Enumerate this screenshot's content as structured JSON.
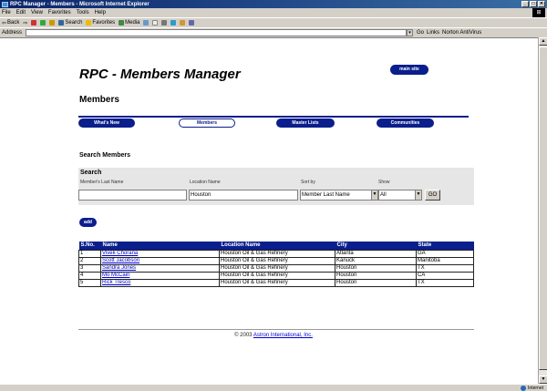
{
  "window": {
    "title": "RPC Manager - Members - Microsoft Internet Explorer",
    "buttons": [
      "_",
      "□",
      "✕"
    ]
  },
  "menu": [
    "File",
    "Edit",
    "View",
    "Favorites",
    "Tools",
    "Help"
  ],
  "toolbar": {
    "back": "Back",
    "search": "Search",
    "favorites": "Favorites",
    "media": "Media"
  },
  "address": {
    "label": "Address",
    "value": "",
    "go": "Go",
    "links": "Links",
    "norton": "Norton AntiVirus"
  },
  "page": {
    "title": "RPC - Members Manager",
    "main_site": "main site",
    "section": "Members",
    "nav": [
      {
        "label": "What's New",
        "active": false
      },
      {
        "label": "Members",
        "active": true
      },
      {
        "label": "Master Lists",
        "active": false
      },
      {
        "label": "Communities",
        "active": false
      }
    ]
  },
  "search": {
    "heading": "Search Members",
    "box_title": "Search",
    "last_name_label": "Member's Last Name",
    "last_name_value": "",
    "location_label": "Location Name",
    "location_value": "Houston",
    "sort_label": "Sort by",
    "sort_value": "Member Last Name",
    "show_label": "Show",
    "show_value": "All",
    "go": "GO"
  },
  "add_label": "add",
  "table": {
    "headers": [
      "S.No.",
      "Name",
      "Location Name",
      "City",
      "State"
    ],
    "rows": [
      [
        "1",
        "Vivek Chorana",
        "Houston Oil & Gas Refinery",
        "Atlanta",
        "GA"
      ],
      [
        "2",
        "Scott Jacobson",
        "Houston Oil & Gas Refinery",
        "Kanuck",
        "Manitoba"
      ],
      [
        "3",
        "Sandra Jones",
        "Houston Oil & Gas Refinery",
        "Houston",
        "TX"
      ],
      [
        "4",
        "Mo McCain",
        "Houston Oil & Gas Refinery",
        "Houston",
        "CA"
      ],
      [
        "5",
        "Rick Tresco",
        "Houston Oil & Gas Refinery",
        "Houston",
        "TX"
      ]
    ]
  },
  "footer": {
    "copyright": "© 2003",
    "company": "Astron International, Inc."
  },
  "status": {
    "zone": "Internet"
  },
  "colors": {
    "brand_navy": "#0a1e8c",
    "link": "#0000cc"
  }
}
